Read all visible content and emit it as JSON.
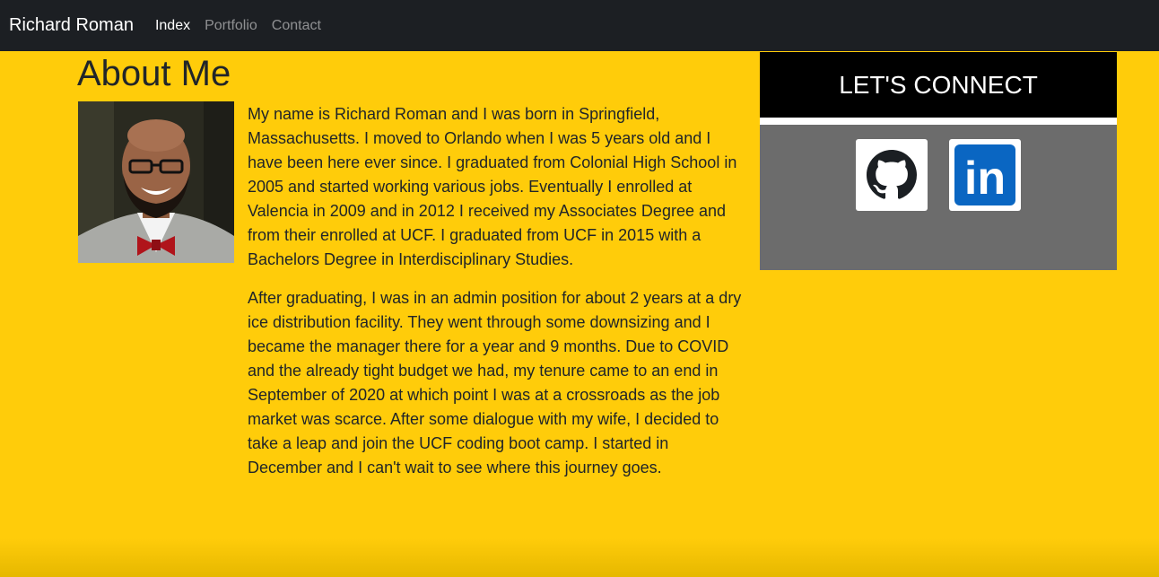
{
  "navbar": {
    "brand": "Richard Roman",
    "links": [
      {
        "label": "Index",
        "active": true
      },
      {
        "label": "Portfolio",
        "active": false
      },
      {
        "label": "Contact",
        "active": false
      }
    ]
  },
  "main": {
    "title": "About Me",
    "paragraphs": [
      "My name is Richard Roman and I was born in Springfield, Massachusetts. I moved to Orlando when I was 5 years old and I have been here ever since. I graduated from Colonial High School in 2005 and started working various jobs. Eventually I enrolled at Valencia in 2009 and in 2012 I received my Associates Degree and from their enrolled at UCF. I graduated from UCF in 2015 with a Bachelors Degree in Interdisciplinary Studies.",
      "After graduating, I was in an admin position for about 2 years at a dry ice distribution facility. They went through some downsizing and I became the manager there for a year and 9 months. Due to COVID and the already tight budget we had, my tenure came to an end in September of 2020 at which point I was at a crossroads as the job market was scarce. After some dialogue with my wife, I decided to take a leap and join the UCF coding boot camp. I started in December and I can't wait to see where this journey goes."
    ]
  },
  "sidebar": {
    "heading": "LET'S CONNECT",
    "icons": [
      "github-icon",
      "linkedin-icon"
    ],
    "linkedin_text": "in"
  },
  "colors": {
    "page_background": "#ffcc0a",
    "navbar": "#1c1f23",
    "connect_header": "#000000",
    "connect_panel": "#6c6c6c",
    "linkedin_blue": "#0a66c2"
  }
}
